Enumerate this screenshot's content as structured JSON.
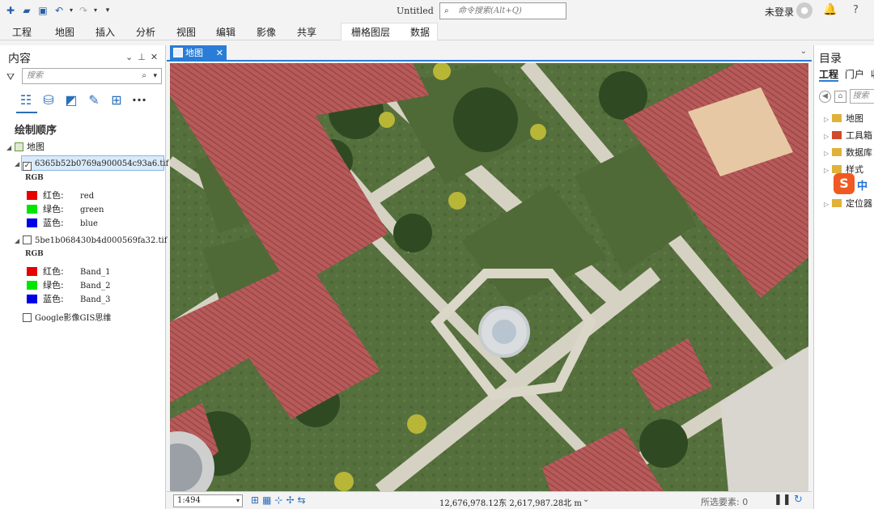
{
  "window": {
    "title": "Untitled",
    "command_search_placeholder": "命令搜索(Alt+Q)",
    "user_status": "未登录",
    "help_label": "?"
  },
  "ribbon": {
    "tabs": [
      "工程",
      "地图",
      "插入",
      "分析",
      "视图",
      "编辑",
      "影像",
      "共享",
      "栅格图层",
      "数据"
    ]
  },
  "contents": {
    "title": "内容",
    "search_placeholder": "搜索",
    "more_label": "···",
    "drawing_order_title": "绘制顺序",
    "map_label": "地图",
    "layers": [
      {
        "name": "6365b52b0769a900054c93a6.tif",
        "checked": true,
        "renderer": "RGB",
        "bands": [
          {
            "label": "红色:",
            "value": "red",
            "color": "#e60000"
          },
          {
            "label": "绿色:",
            "value": "green",
            "color": "#00e600"
          },
          {
            "label": "蓝色:",
            "value": "blue",
            "color": "#0000e6"
          }
        ]
      },
      {
        "name": "5be1b068430b4d000569fa32.tif",
        "checked": false,
        "renderer": "RGB",
        "bands": [
          {
            "label": "红色:",
            "value": "Band_1",
            "color": "#e60000"
          },
          {
            "label": "绿色:",
            "value": "Band_2",
            "color": "#00e600"
          },
          {
            "label": "蓝色:",
            "value": "Band_3",
            "color": "#0000e6"
          }
        ]
      },
      {
        "name": "Google影像GIS思维",
        "checked": false
      }
    ]
  },
  "map_view": {
    "tab_label": "地图"
  },
  "status_bar": {
    "scale": "1:494",
    "coordinates": "12,676,978.12东 2,617,987.28北 m",
    "selected_features": "所选要素: 0"
  },
  "catalog": {
    "title": "目录",
    "tabs": [
      "工程",
      "门户",
      "收"
    ],
    "search_placeholder": "搜索",
    "items": [
      {
        "label": "地图",
        "color": "#e0b23a"
      },
      {
        "label": "工具箱",
        "color": "#d24a2a"
      },
      {
        "label": "数据库",
        "color": "#e0b23a"
      },
      {
        "label": "样式",
        "color": "#e0b23a"
      },
      {
        "label": "定位器",
        "color": "#e0b23a"
      }
    ],
    "ime_label": "中"
  }
}
